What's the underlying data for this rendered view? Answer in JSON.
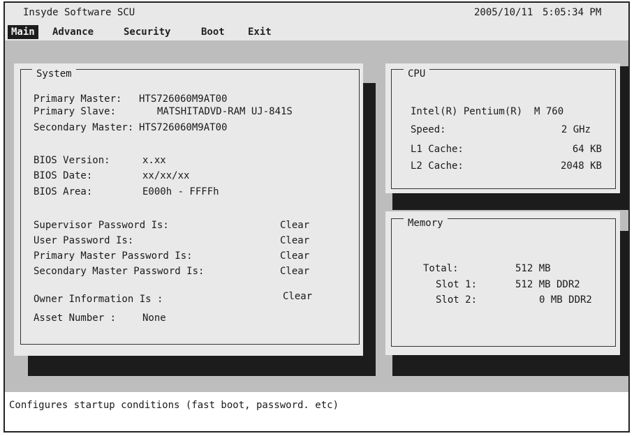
{
  "app": {
    "title": "Insyde Software SCU",
    "date": "2005/10/11",
    "time": "5:05:34 PM"
  },
  "menu": [
    {
      "label": "Main",
      "active": true
    },
    {
      "label": "Advance",
      "active": false
    },
    {
      "label": "Security",
      "active": false
    },
    {
      "label": "Boot",
      "active": false
    },
    {
      "label": "Exit",
      "active": false
    }
  ],
  "system": {
    "title": "System",
    "drives": [
      {
        "label": "Primary Master:",
        "value": "HTS726060M9AT00"
      },
      {
        "label": "Primary Slave:",
        "value": "MATSHITADVD-RAM UJ-841S"
      },
      {
        "label": "Secondary Master:",
        "value": "HTS726060M9AT00"
      }
    ],
    "bios": [
      {
        "label": "BIOS Version:",
        "value": "x.xx"
      },
      {
        "label": "BIOS Date:",
        "value": "xx/xx/xx"
      },
      {
        "label": "BIOS Area:",
        "value": "E000h - FFFFh"
      }
    ],
    "passwords": [
      {
        "label": "Supervisor Password Is:",
        "value": "Clear"
      },
      {
        "label": "User Password Is:",
        "value": "Clear"
      },
      {
        "label": "Primary Master Password Is:",
        "value": "Clear"
      },
      {
        "label": "Secondary Master Password Is:",
        "value": "Clear"
      }
    ],
    "owner": {
      "label": "Owner Information Is :",
      "value": "Clear"
    },
    "asset": {
      "label": "Asset Number :",
      "value": "None"
    }
  },
  "cpu": {
    "title": "CPU",
    "name": "Intel(R) Pentium(R)  M 760",
    "rows": [
      {
        "label": "Speed:",
        "value": "2 GHz"
      },
      {
        "label": "L1 Cache:",
        "value": "64 KB"
      },
      {
        "label": "L2 Cache:",
        "value": "2048 KB"
      }
    ]
  },
  "memory": {
    "title": "Memory",
    "rows": [
      {
        "label": "Total:",
        "value": "512 MB"
      },
      {
        "label": "Slot 1:",
        "value": "512 MB DDR2"
      },
      {
        "label": "Slot 2:",
        "value": "0 MB DDR2"
      }
    ]
  },
  "status": {
    "help": "Configures startup conditions (fast boot, password. etc)"
  },
  "colors": {
    "work_area": "#bdbdbd",
    "panel": "#e9e9e9",
    "shadow": "#1c1c1c",
    "menu_active_bg": "#1c1c1c"
  }
}
